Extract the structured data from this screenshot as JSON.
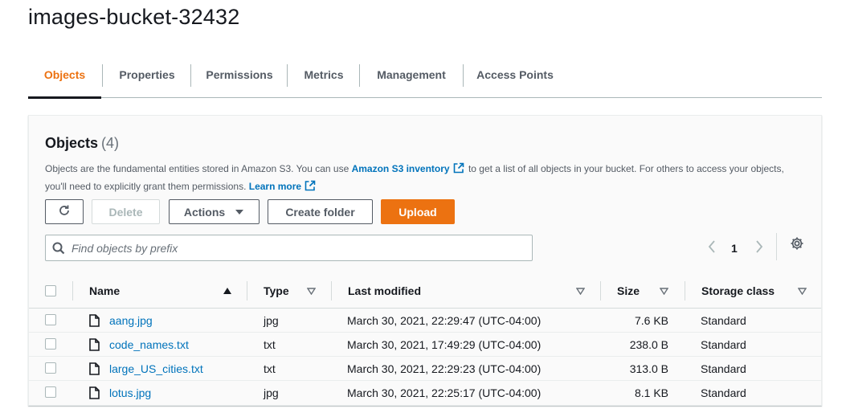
{
  "bucket": {
    "name": "images-bucket-32432"
  },
  "tabs": [
    {
      "label": "Objects",
      "active": true
    },
    {
      "label": "Properties"
    },
    {
      "label": "Permissions"
    },
    {
      "label": "Metrics"
    },
    {
      "label": "Management"
    },
    {
      "label": "Access Points"
    }
  ],
  "objects_panel": {
    "title": "Objects",
    "count": "(4)",
    "description": {
      "part1": "Objects are the fundamental entities stored in Amazon S3. You can use ",
      "link1": "Amazon S3 inventory",
      "part2": " to get a list of all objects in your bucket. For others to access your objects, you'll need to explicitly grant them permissions. ",
      "link2": "Learn more"
    },
    "toolbar": {
      "refresh_icon": "refresh-icon",
      "delete_label": "Delete",
      "actions_label": "Actions",
      "create_folder_label": "Create folder",
      "upload_label": "Upload"
    },
    "search": {
      "placeholder": "Find objects by prefix",
      "value": ""
    },
    "pagination": {
      "current_page": "1"
    },
    "accent_color": "#ec7211",
    "link_color": "#0073bb"
  },
  "table": {
    "columns": {
      "name": "Name",
      "type": "Type",
      "last_modified": "Last modified",
      "size": "Size",
      "storage_class": "Storage class"
    },
    "rows": [
      {
        "name": "aang.jpg",
        "type": "jpg",
        "last_modified": "March 30, 2021, 22:29:47 (UTC-04:00)",
        "size": "7.6 KB",
        "storage_class": "Standard"
      },
      {
        "name": "code_names.txt",
        "type": "txt",
        "last_modified": "March 30, 2021, 17:49:29 (UTC-04:00)",
        "size": "238.0 B",
        "storage_class": "Standard"
      },
      {
        "name": "large_US_cities.txt",
        "type": "txt",
        "last_modified": "March 30, 2021, 22:29:23 (UTC-04:00)",
        "size": "313.0 B",
        "storage_class": "Standard"
      },
      {
        "name": "lotus.jpg",
        "type": "jpg",
        "last_modified": "March 30, 2021, 22:25:17 (UTC-04:00)",
        "size": "8.1 KB",
        "storage_class": "Standard"
      }
    ]
  }
}
